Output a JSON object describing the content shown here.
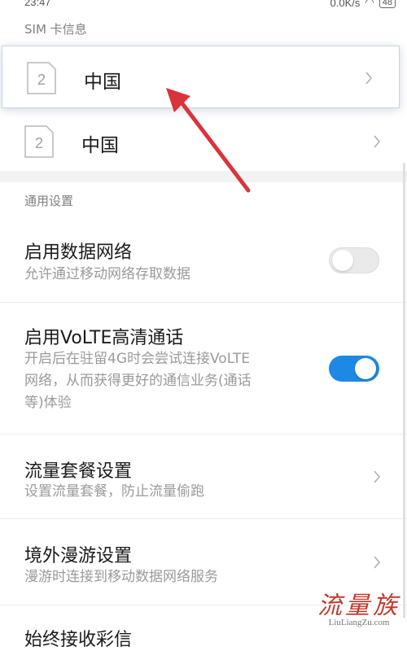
{
  "status_bar": {
    "time": "23:47",
    "network_speed": "0.0K/s",
    "battery": "48"
  },
  "sim_section": {
    "header": "SIM 卡信息",
    "cards": [
      {
        "slot": "2",
        "name": "中国",
        "highlighted": true
      },
      {
        "slot": "2",
        "name": "中国",
        "highlighted": false
      }
    ]
  },
  "general_section": {
    "header": "通用设置",
    "items": [
      {
        "title": "启用数据网络",
        "subtitle": "允许通过移动网络存取数据",
        "control": "toggle",
        "enabled": false
      },
      {
        "title": "启用VoLTE高清通话",
        "subtitle_lines": [
          "开启后在驻留4G时会尝试连接VoLTE",
          "网络，从而获得更好的通信业务(通话",
          "等)体验"
        ],
        "control": "toggle",
        "enabled": true
      },
      {
        "title": "流量套餐设置",
        "subtitle": "设置流量套餐，防止流量偷跑",
        "control": "chevron"
      },
      {
        "title": "境外漫游设置",
        "subtitle": "漫游时连接到移动数据网络服务",
        "control": "chevron"
      },
      {
        "title": "始终接收彩信"
      }
    ]
  },
  "colors": {
    "toggle_on": "#1e88e5",
    "toggle_off": "#eaeaea",
    "annotation_arrow": "#d9343a",
    "watermark": "#c0392b"
  },
  "watermark": {
    "logo_text": "流量族",
    "url": "LiuLiangZu.com"
  }
}
